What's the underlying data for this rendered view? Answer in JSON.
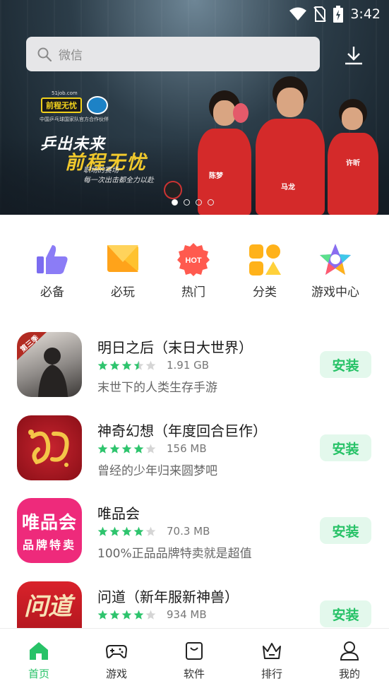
{
  "status_bar": {
    "time": "3:42"
  },
  "search": {
    "placeholder": "微信"
  },
  "banner": {
    "brand_logo": "前程无忧",
    "brand_site": "51job.com",
    "brand_caption": "中国乒乓球国家队官方合作伙伴",
    "slogan_line1": "乒出未来",
    "slogan_line2": "前程无忧",
    "slogan_line3": "职场的赛场",
    "slogan_line4": "每一次出击都全力以赴",
    "player_names": [
      "陈梦",
      "马龙",
      "许昕"
    ],
    "page_count": 4,
    "active_page": 1
  },
  "categories": [
    {
      "label": "必备",
      "icon": "thumbs-up-icon"
    },
    {
      "label": "必玩",
      "icon": "folded-card-icon"
    },
    {
      "label": "热门",
      "icon": "hot-badge-icon",
      "badge": "HOT"
    },
    {
      "label": "分类",
      "icon": "grid-shapes-icon"
    },
    {
      "label": "游戏中心",
      "icon": "star-icon"
    }
  ],
  "apps": [
    {
      "name": "明日之后（末日大世界）",
      "rating": 3.5,
      "size": "1.91 GB",
      "description": "末世下的人类生存手游",
      "install_label": "安装",
      "icon_badge": "第三季"
    },
    {
      "name": "神奇幻想（年度回合巨作）",
      "rating": 4,
      "size": "156 MB",
      "description": "曾经的少年归来圆梦吧",
      "install_label": "安装",
      "icon_badge": ""
    },
    {
      "name": "唯品会",
      "rating": 4,
      "size": "70.3 MB",
      "description": "100%正品品牌特卖就是超值",
      "install_label": "安装",
      "icon_text_1": "唯品会",
      "icon_text_2": "品牌特卖"
    },
    {
      "name": "问道（新年服新神兽）",
      "rating": 4,
      "size": "934 MB",
      "description": "",
      "install_label": "安装",
      "icon_text_1": "问道"
    }
  ],
  "bottom_nav": [
    {
      "label": "首页",
      "icon": "home-icon",
      "active": true
    },
    {
      "label": "游戏",
      "icon": "gamepad-icon",
      "active": false
    },
    {
      "label": "软件",
      "icon": "software-bag-icon",
      "active": false
    },
    {
      "label": "排行",
      "icon": "crown-icon",
      "active": false
    },
    {
      "label": "我的",
      "icon": "user-icon",
      "active": false
    }
  ],
  "colors": {
    "accent": "#27c267",
    "install_bg": "#e3f8ec",
    "star_filled": "#2ec46d",
    "star_empty": "#d5d5d5"
  }
}
